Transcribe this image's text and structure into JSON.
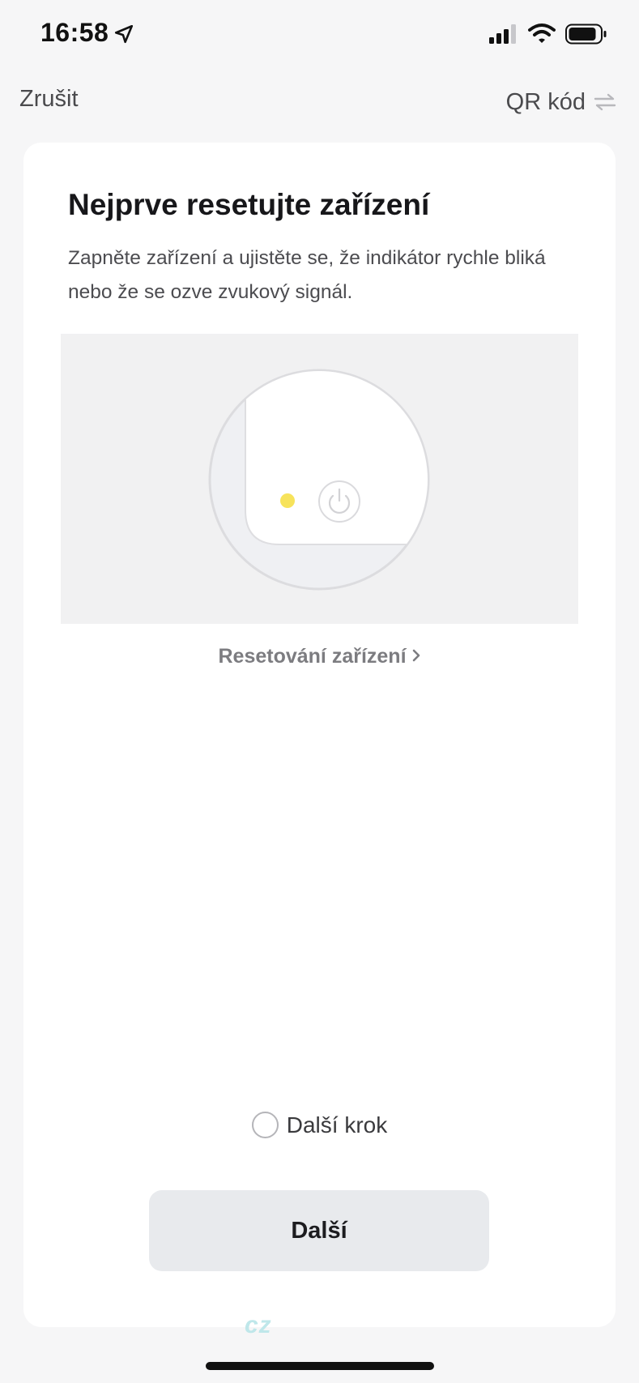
{
  "status_bar": {
    "time": "16:58",
    "icons": [
      "location-arrow-icon",
      "cellular-signal-icon",
      "wifi-icon",
      "battery-icon"
    ]
  },
  "nav": {
    "cancel_label": "Zrušit",
    "qr_label": "QR kód",
    "qr_icon": "swap-arrows-icon"
  },
  "content": {
    "title": "Nejprve resetujte zařízení",
    "description": "Zapněte zařízení a ujistěte se, že indikátor rychle bliká nebo že se ozve zvukový signál.",
    "reset_link": "Resetování zařízení",
    "reset_link_icon": "chevron-right-icon"
  },
  "illustration": {
    "indicator_color": "#f7e35b",
    "icon": "power-icon"
  },
  "footer": {
    "next_step_label": "Další krok",
    "next_step_checked": false,
    "next_button_label": "Další"
  },
  "watermark": "cz",
  "colors": {
    "background": "#f6f6f7",
    "card": "#ffffff",
    "button": "#e8eaed",
    "indicator": "#f7e35b"
  }
}
